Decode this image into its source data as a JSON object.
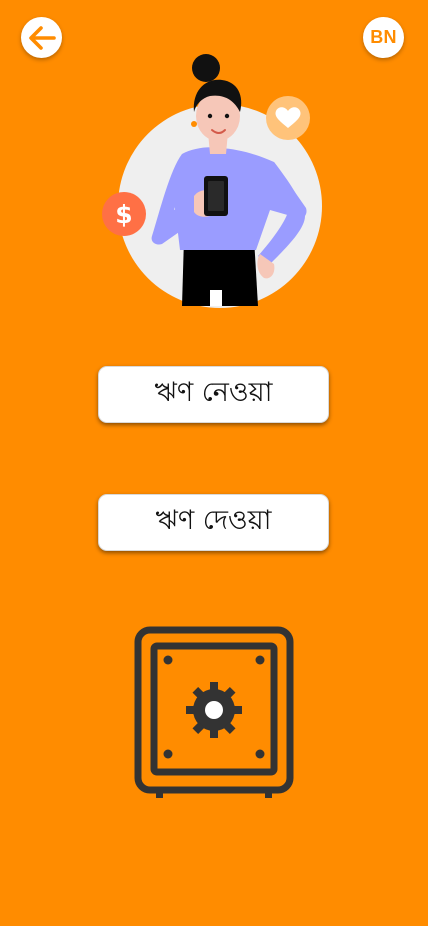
{
  "header": {
    "back_icon": "arrow-left-icon",
    "language_code": "BN"
  },
  "actions": {
    "take_loan_label": "ঋণ নেওয়া",
    "give_loan_label": "ঋণ দেওয়া"
  },
  "icons": {
    "vault": "safe-vault-icon",
    "coin": "dollar-coin-icon",
    "heart": "heart-icon"
  },
  "colors": {
    "background": "#FF8C00",
    "accent": "#FF8C00",
    "coin": "#FF7045",
    "heart_badge": "#FFC37A",
    "shirt": "#9A9CFF",
    "vault_stroke": "#333333"
  }
}
